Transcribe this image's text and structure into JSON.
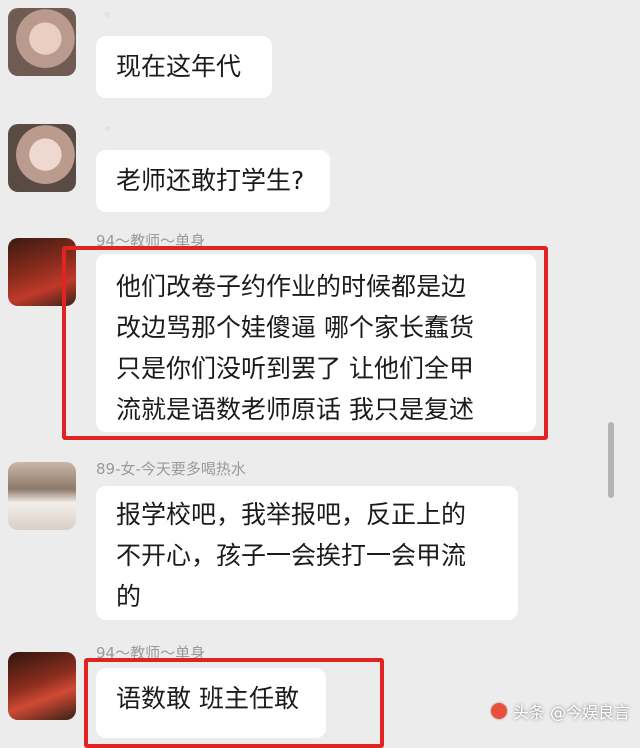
{
  "chat": {
    "messages": [
      {
        "nickname": "",
        "lines": [
          "现在这年代"
        ]
      },
      {
        "nickname": "",
        "lines": [
          "老师还敢打学生?"
        ]
      },
      {
        "nickname": "94～教师～单身",
        "lines": [
          "他们改卷子约作业的时候都是边",
          "改边骂那个娃傻逼 哪个家长蠢货",
          "只是你们没听到罢了 让他们全甲",
          "流就是语数老师原话 我只是复述"
        ]
      },
      {
        "nickname": "89-女-今天要多喝热水",
        "lines": [
          "报学校吧，我举报吧，反正上的",
          "不开心，孩子一会挨打一会甲流",
          "的"
        ]
      },
      {
        "nickname": "94～教师～单身",
        "lines": [
          "语数敢 班主任敢"
        ]
      }
    ]
  },
  "watermark": {
    "text": "头条 @今娱良言"
  },
  "colors": {
    "highlight": "#e02424",
    "bubble": "#ffffff",
    "background": "#ececec"
  }
}
